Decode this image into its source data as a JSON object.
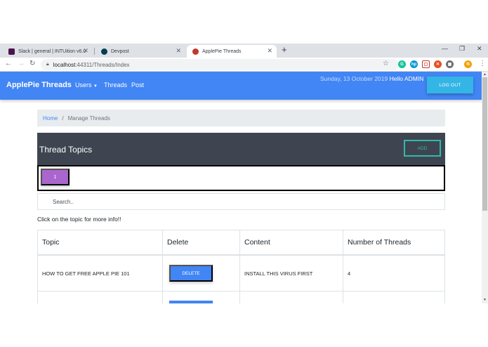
{
  "browser": {
    "tabs": [
      {
        "title": "Slack | general | INTUition v6.0",
        "favicon_color": "#4a154b"
      },
      {
        "title": "Devpost",
        "favicon_color": "#003e54"
      },
      {
        "title": "ApplePie Threads",
        "favicon_color": "#c0392b"
      }
    ],
    "url_host": "localhost",
    "url_path": ":44311/Threads/Index",
    "profile_initial": "N"
  },
  "navbar": {
    "brand": "ApplePie Threads",
    "links": [
      "Users",
      "Threads",
      "Post"
    ],
    "date": "Sunday, 13 October 2019",
    "greeting": "Hello ADMIN",
    "logout_label": "LOG OUT"
  },
  "breadcrumb": {
    "home": "Home",
    "separator": "/",
    "current": "Manage Threads"
  },
  "topics": {
    "title": "Thread Topics",
    "add_label": "ADD",
    "pages": [
      "1"
    ]
  },
  "search": {
    "placeholder": "Search.."
  },
  "hint": "Click on the topic for more info!!",
  "table": {
    "headers": [
      "Topic",
      "Delete",
      "Content",
      "Number of Threads"
    ],
    "rows": [
      {
        "topic": "HOW TO GET FREE APPLE PIE 101",
        "delete_label": "DELETE",
        "content": "INSTALL THIS VIRUS FIRST",
        "count": "4"
      }
    ]
  },
  "colors": {
    "primary": "#4285f4",
    "info": "#33b5e5",
    "secondary": "#aa66cc",
    "teal": "#2bbbad",
    "dark_header": "#3f4550"
  }
}
